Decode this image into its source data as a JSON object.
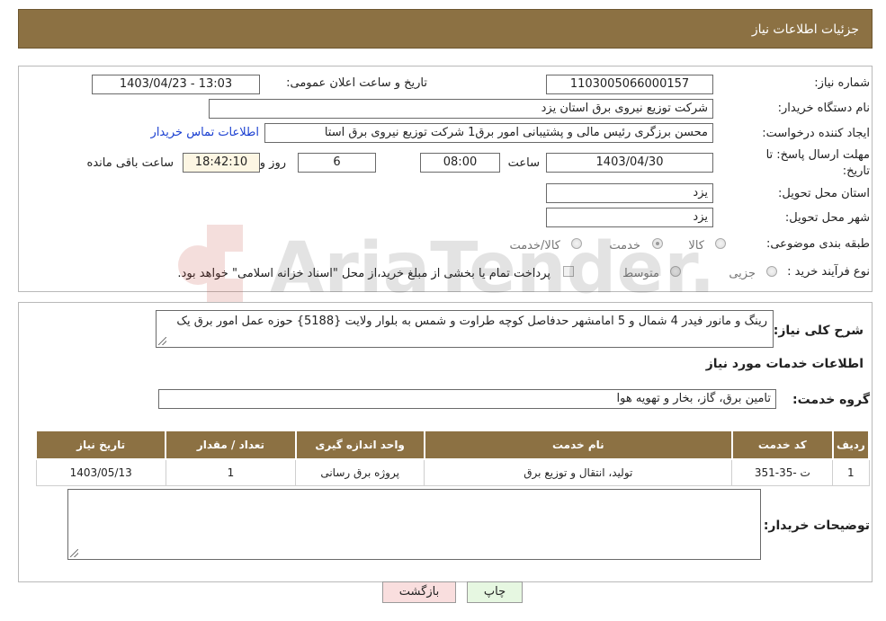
{
  "header": {
    "title": "جزئیات اطلاعات نیاز"
  },
  "form": {
    "need_number_label": "شماره نیاز:",
    "need_number": "1103005066000157",
    "announce_label": "تاریخ و ساعت اعلان عمومی:",
    "announce_value": "1403/04/23 - 13:03",
    "buyer_org_label": "نام دستگاه خریدار:",
    "buyer_org": "شرکت توزیع نیروی برق استان یزد",
    "creator_label": "ایجاد کننده درخواست:",
    "creator": "محسن  برزگری رئیس مالی و پشتیبانی امور برق1 شرکت توزیع نیروی برق استا",
    "contact_link": "اطلاعات تماس خریدار",
    "deadline_label_1": "مهلت ارسال پاسخ: تا",
    "deadline_label_2": "تاریخ:",
    "deadline_date": "1403/04/30",
    "time_label": "ساعت",
    "deadline_time": "08:00",
    "days_value": "6",
    "days_label": "روز و",
    "remaining_time": "18:42:10",
    "remaining_label": "ساعت باقی مانده",
    "province_label": "استان محل تحویل:",
    "province": "یزد",
    "city_label": "شهر محل تحویل:",
    "city": "یزد",
    "category_label": "طبقه بندی موضوعی:",
    "category_options": [
      "کالا",
      "خدمت",
      "کالا/خدمت"
    ],
    "category_selected": "خدمت",
    "process_label": "نوع فرآیند خرید :",
    "process_options": [
      "جزیی",
      "متوسط"
    ],
    "payment_note": "پرداخت تمام یا بخشی از مبلغ خرید،از محل \"اسناد خزانه اسلامی\" خواهد بود."
  },
  "description": {
    "label": "شرح کلی نیاز:",
    "text": "رینگ و مانور فیدر 4 شمال و 5 امامشهر حدفاصل کوچه طراوت و شمس به بلوار ولایت {5188} حوزه عمل امور برق یک"
  },
  "services": {
    "section_title": "اطلاعات خدمات مورد نیاز",
    "group_label": "گروه خدمت:",
    "group_value": "تامین برق، گاز، بخار و تهویه هوا",
    "table": {
      "headers": [
        "ردیف",
        "کد خدمت",
        "نام خدمت",
        "واحد اندازه گیری",
        "تعداد / مقدار",
        "تاریخ نیاز"
      ],
      "rows": [
        [
          "1",
          "ت -35-351",
          "تولید، انتقال و توزیع برق",
          "پروژه برق رسانی",
          "1",
          "1403/05/13"
        ]
      ]
    }
  },
  "buyer_notes": {
    "label": "توضیحات خریدار:",
    "value": ""
  },
  "buttons": {
    "print": "چاپ",
    "back": "بازگشت"
  },
  "colors": {
    "header_bg": "#8c7143",
    "back_button_bg": "#f9dede",
    "print_button_bg": "#e6f7e1",
    "link": "#1a3fd1"
  },
  "watermark": {
    "text": "AriaTender.net"
  }
}
